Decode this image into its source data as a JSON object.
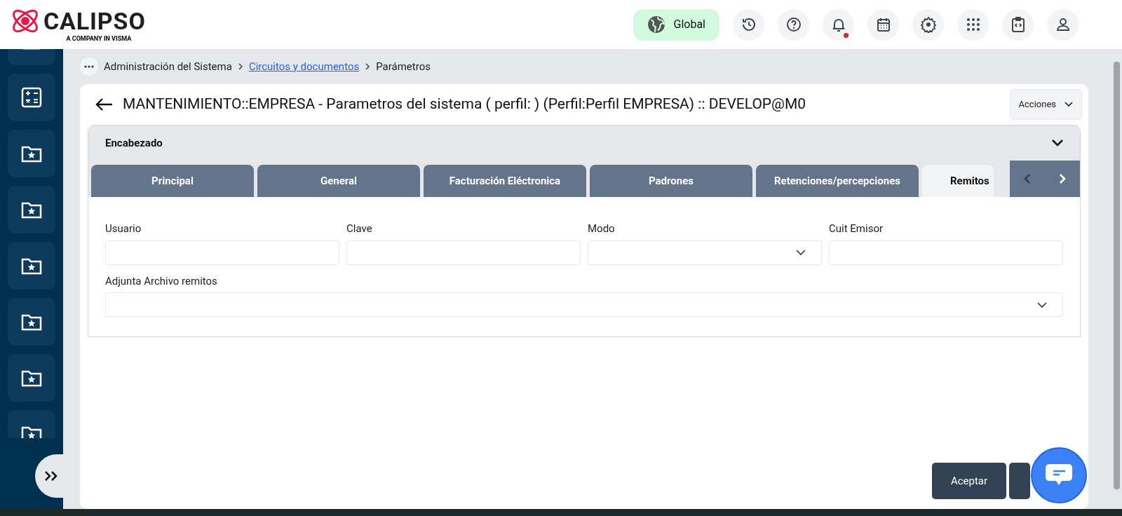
{
  "logo": {
    "name": "CALIPSO",
    "tagline": "A COMPANY IN VISMA"
  },
  "header": {
    "scope_button": "Global",
    "notifications_unread": true
  },
  "sidebar": {
    "items": [
      {
        "kind": "partial-top"
      },
      {
        "kind": "calculator"
      },
      {
        "kind": "folder-star"
      },
      {
        "kind": "folder-star"
      },
      {
        "kind": "folder-star"
      },
      {
        "kind": "folder-star"
      },
      {
        "kind": "folder-star"
      },
      {
        "kind": "folder-star"
      }
    ]
  },
  "breadcrumb": [
    {
      "label": "Administración del Sistema",
      "link": false
    },
    {
      "label": "Circuitos y documentos",
      "link": true
    },
    {
      "label": "Parámetros",
      "link": false
    }
  ],
  "page": {
    "title": "MANTENIMIENTO::EMPRESA - Parametros del sistema ( perfil: ) (Perfil:Perfil EMPRESA) :: DEVELOP@M0",
    "actions": "Acciones"
  },
  "section": {
    "title": "Encabezado",
    "expanded": true
  },
  "tabs": [
    {
      "label": "Principal",
      "selected": false
    },
    {
      "label": "General",
      "selected": false
    },
    {
      "label": "Facturación Eléctronica",
      "selected": false
    },
    {
      "label": "Padrones",
      "selected": false
    },
    {
      "label": "Retenciones/percepciones",
      "selected": false
    },
    {
      "label": "Remitos",
      "selected": true
    }
  ],
  "tab_scroll": {
    "prev_disabled": true,
    "next_disabled": false
  },
  "fields": [
    {
      "label": "Usuario",
      "kind": "text",
      "wide": false
    },
    {
      "label": "Clave",
      "kind": "text",
      "wide": false
    },
    {
      "label": "Modo",
      "kind": "select",
      "wide": false
    },
    {
      "label": "Cuit Emisor",
      "kind": "text",
      "wide": false
    },
    {
      "label": "Adjunta Archivo remitos",
      "kind": "select",
      "wide": true
    }
  ],
  "footer_buttons": [
    {
      "kind": "primary",
      "label": "Aceptar"
    },
    {
      "kind": "covered"
    }
  ]
}
